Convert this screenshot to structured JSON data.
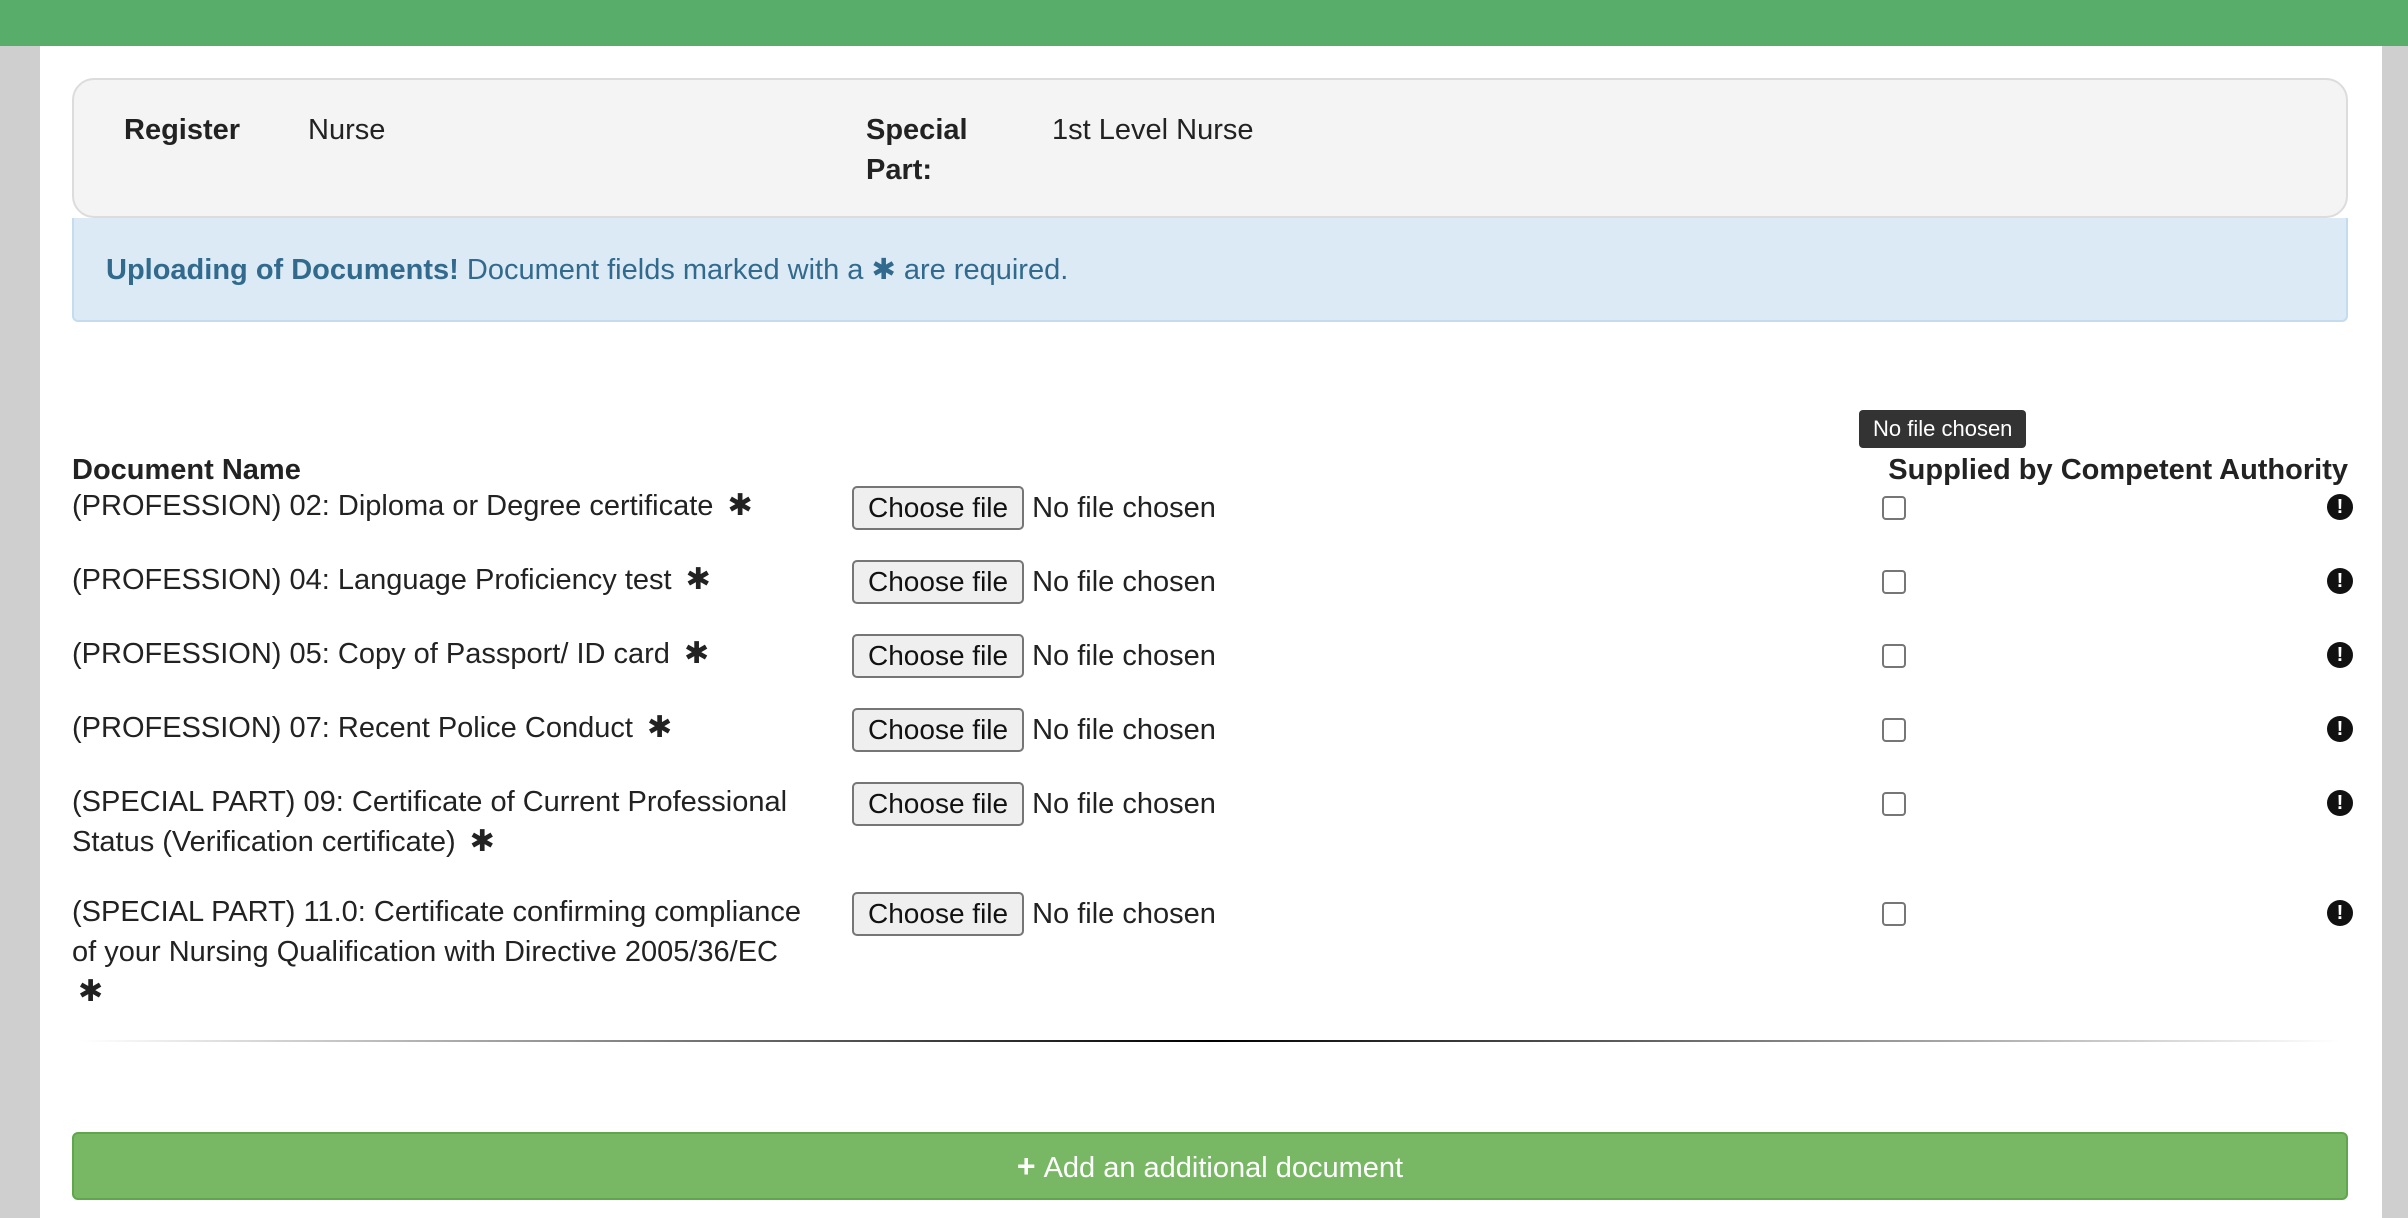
{
  "register": {
    "register_label": "Register",
    "register_value": "Nurse",
    "special_part_label_line1": "Special",
    "special_part_label_line2": "Part:",
    "special_part_value": "1st Level Nurse"
  },
  "alert": {
    "title": "Uploading of Documents!",
    "message_before": "Document fields marked with a",
    "star": "✱",
    "message_after": "are required."
  },
  "table": {
    "col_document_name": "Document Name",
    "col_supplied": "Supplied by Competent Authority"
  },
  "tooltip": "No file chosen",
  "required_marker": "✱",
  "documents": [
    {
      "name": "(PROFESSION) 02: Diploma or Degree certificate",
      "button": "Choose file",
      "status": "No file chosen"
    },
    {
      "name": "(PROFESSION) 04: Language Proficiency test",
      "button": "Choose file",
      "status": "No file chosen"
    },
    {
      "name": "(PROFESSION) 05: Copy of Passport/ ID card",
      "button": "Choose file",
      "status": "No file chosen"
    },
    {
      "name": "(PROFESSION) 07: Recent Police Conduct",
      "button": "Choose file",
      "status": "No file chosen"
    },
    {
      "name": "(SPECIAL PART) 09: Certificate of Current Professional Status (Verification certificate)",
      "button": "Choose file",
      "status": "No file chosen"
    },
    {
      "name": "(SPECIAL PART) 11.0: Certificate confirming compliance of your Nursing Qualification with Directive 2005/36/EC",
      "button": "Choose file",
      "status": "No file chosen"
    }
  ],
  "add_button": {
    "icon": "plus-icon",
    "label": "Add an additional document"
  },
  "colors": {
    "topbar": "#58ad6a",
    "alert_bg": "#dceaf5",
    "alert_text": "#316a8d",
    "add_button": "#78b865"
  }
}
